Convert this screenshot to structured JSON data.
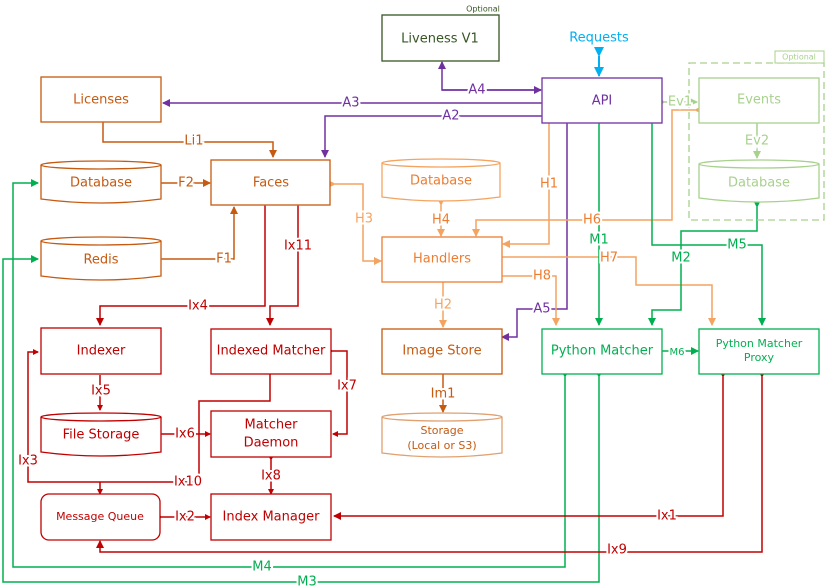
{
  "colors": {
    "orange_dark": "#c55a11",
    "orange_light": "#f4a460",
    "orange_mid": "#ed7d31",
    "purple": "#7030a0",
    "green": "#00b050",
    "green_light": "#a9d18e",
    "red": "#c00000",
    "blue": "#00b0f0",
    "dark_green": "#375623"
  },
  "nodes": {
    "liveness": {
      "label": "Liveness V1",
      "tag": "Optional"
    },
    "requests": {
      "label": "Requests"
    },
    "api": {
      "label": "API"
    },
    "licenses": {
      "label": "Licenses"
    },
    "events": {
      "label": "Events"
    },
    "events_db": {
      "label": "Database"
    },
    "events_group": {
      "tag": "Optional"
    },
    "faces_db": {
      "label": "Database"
    },
    "faces": {
      "label": "Faces"
    },
    "redis": {
      "label": "Redis"
    },
    "handlers_db": {
      "label": "Database"
    },
    "handlers": {
      "label": "Handlers"
    },
    "image_store": {
      "label": "Image Store"
    },
    "storage": {
      "label_line1": "Storage",
      "label_line2": "(Local or S3)"
    },
    "python_matcher": {
      "label": "Python Matcher"
    },
    "python_matcher_proxy": {
      "label_line1": "Python Matcher",
      "label_line2": "Proxy"
    },
    "indexer": {
      "label": "Indexer"
    },
    "indexed_matcher": {
      "label": "Indexed Matcher"
    },
    "file_storage": {
      "label": "File Storage"
    },
    "matcher_daemon": {
      "label_line1": "Matcher",
      "label_line2": "Daemon"
    },
    "message_queue": {
      "label": "Message Queue"
    },
    "index_manager": {
      "label": "Index Manager"
    }
  },
  "edges": {
    "A2": "A2",
    "A3": "A3",
    "A4": "A4",
    "A5": "A5",
    "Li1": "Li1",
    "F1": "F1",
    "F2": "F2",
    "H1": "H1",
    "H2": "H2",
    "H3": "H3",
    "H4": "H4",
    "H6": "H6",
    "H7": "H7",
    "H8": "H8",
    "Im1": "Im1",
    "Ev1": "Ev1",
    "Ev2": "Ev2",
    "M1": "M1",
    "M2": "M2",
    "M3": "M3",
    "M4": "M4",
    "M5": "M5",
    "M6": "M6",
    "Ix1": "Ix1",
    "Ix2": "Ix2",
    "Ix3": "Ix3",
    "Ix4": "Ix4",
    "Ix5": "Ix5",
    "Ix6": "Ix6",
    "Ix7": "Ix7",
    "Ix8": "Ix8",
    "Ix9": "Ix9",
    "Ix10": "Ix10",
    "Ix11": "Ix11"
  }
}
